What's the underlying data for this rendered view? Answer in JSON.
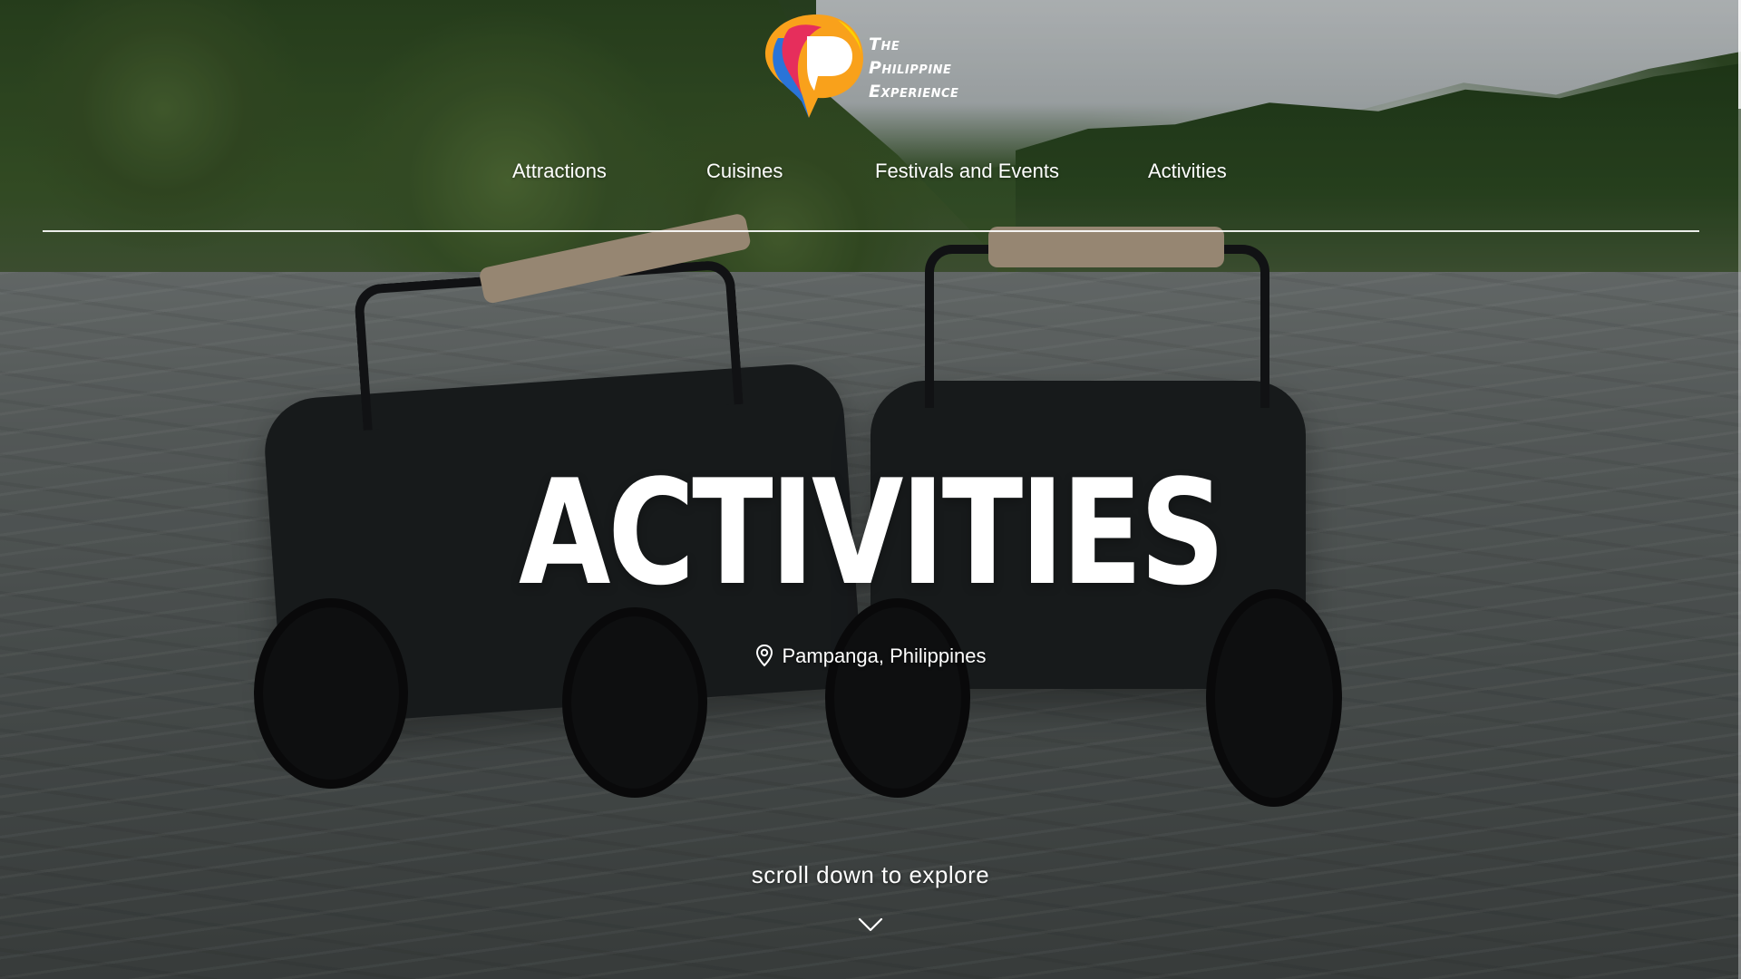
{
  "brand": {
    "logo_line1": "The",
    "logo_line2": "Philippine",
    "logo_line3": "Experience",
    "logo_colors": [
      "#e62e5c",
      "#f9a11b",
      "#2a74d8",
      "#fdd200"
    ]
  },
  "nav": {
    "items": [
      {
        "label": "Attractions"
      },
      {
        "label": "Cuisines"
      },
      {
        "label": "Festivals and Events"
      },
      {
        "label": "Activities"
      }
    ]
  },
  "hero": {
    "title": "ACTIVITIES",
    "location": "Pampanga, Philippines",
    "location_icon": "map-pin-icon",
    "scroll_prompt": "scroll down to explore",
    "scroll_icon": "chevron-down-icon"
  }
}
